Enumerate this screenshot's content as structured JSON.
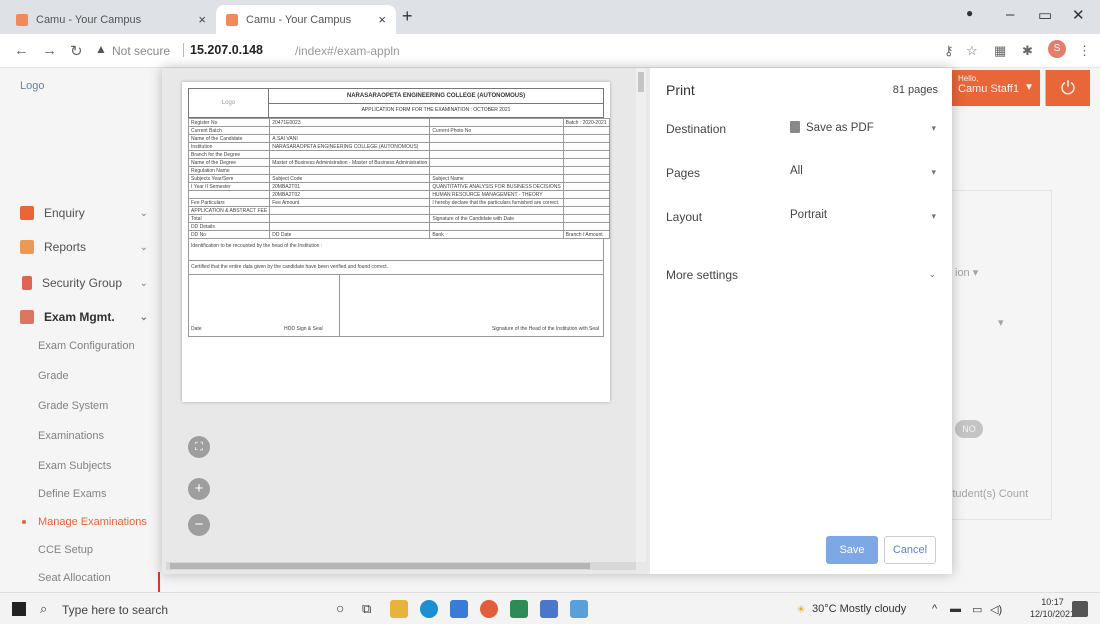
{
  "browser": {
    "tabs": [
      {
        "title": "Camu - Your Campus"
      },
      {
        "title": "Camu - Your Campus"
      }
    ],
    "new_tab": "+",
    "security_label": "Not secure",
    "url_host": "15.207.0.148",
    "url_path": "/index#/exam-appln"
  },
  "app": {
    "logo_alt": "Logo",
    "user": {
      "greeting": "Hello,",
      "name": "Camu Staff1"
    },
    "sidebar": [
      {
        "label": "Enquiry",
        "color": "#f26b3a"
      },
      {
        "label": "Reports",
        "color": "#f5a15a"
      },
      {
        "label": "Security Group",
        "color": "#e86a5a"
      },
      {
        "label": "Exam Mgmt.",
        "color": "#e77b62"
      }
    ],
    "submenu": [
      {
        "label": "Exam Configuration"
      },
      {
        "label": "Grade"
      },
      {
        "label": "Grade System"
      },
      {
        "label": "Examinations"
      },
      {
        "label": "Exam Subjects"
      },
      {
        "label": "Define Exams"
      },
      {
        "label": "Manage Examinations"
      },
      {
        "label": "CCE Setup"
      },
      {
        "label": "Seat Allocation"
      }
    ],
    "background": {
      "toggle_text": "NO",
      "count_label": "Student(s) Count"
    }
  },
  "print_dialog": {
    "title": "Print",
    "page_count": "81 pages",
    "destination": {
      "label": "Destination",
      "value": "Save as PDF"
    },
    "pages": {
      "label": "Pages",
      "value": "All"
    },
    "layout": {
      "label": "Layout",
      "value": "Portrait"
    },
    "more_settings": "More settings",
    "save_button": "Save",
    "cancel_button": "Cancel"
  },
  "document": {
    "logo_alt": "Logo",
    "college": "NARASARAOPETA ENGINEERING COLLEGE (AUTONOMOUS)",
    "subtitle": "APPLICATION FORM FOR THE EXAMINATION : OCTOBER 2021",
    "rows": [
      [
        "Register No",
        "20471E0023",
        "",
        "Batch : 2020-2021"
      ],
      [
        "Current Batch",
        "",
        "Current Photo No",
        ""
      ],
      [
        "Name of the Candidate",
        "A.SAI VANI",
        "",
        ""
      ],
      [
        "Institution",
        "NARASARAOPETA ENGINEERING COLLEGE (AUTONOMOUS)",
        "",
        ""
      ],
      [
        "Branch for the Degree",
        "",
        "",
        ""
      ],
      [
        "Name of the Degree",
        "Master of Business Administration - Master of Business Administration",
        "",
        ""
      ],
      [
        "Regulation Name",
        "",
        "",
        ""
      ],
      [
        "Subjects Year/Sem",
        "Subject Code",
        "Subject Name",
        ""
      ],
      [
        "I Year II Semester",
        "20MBA2T01",
        "QUANTITATIVE ANALYSIS FOR BUSINESS DECISIONS",
        ""
      ],
      [
        "",
        "20MBA2T02",
        "HUMAN RESOURCE MANAGEMENT - THEORY",
        ""
      ],
      [
        "Fee Particulars",
        "Fee Amount",
        "I hereby declare that the particulars furnished are correct.",
        ""
      ],
      [
        "APPLICATION & ABSTRACT FEE",
        "",
        "",
        ""
      ],
      [
        "Total",
        "",
        "Signature of the Candidate with Date",
        ""
      ],
      [
        "DD Details",
        "",
        "",
        ""
      ],
      [
        "DD No",
        "DD Date",
        "Bank",
        "Branch / Amount"
      ]
    ],
    "note1": "Identification to be recounted by the head of the Institution :",
    "note2": "Certified that the entire data given by the candidate have been verified and found correct.",
    "foot_left": "Date",
    "foot_mid": "HOD Sign & Seal",
    "foot_right": "Signature of the Head of the Institution with Seal"
  },
  "taskbar": {
    "search_placeholder": "Type here to search",
    "weather": "30°C  Mostly cloudy",
    "time": "10:17",
    "date": "12/10/2021"
  }
}
